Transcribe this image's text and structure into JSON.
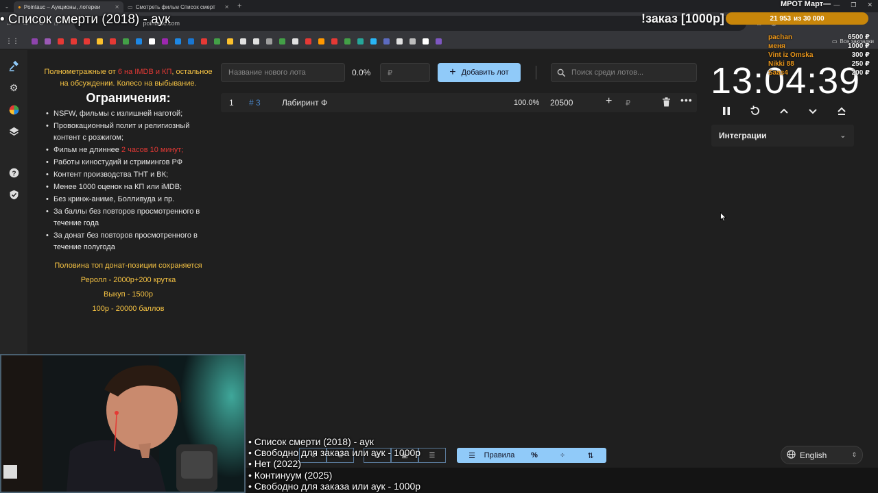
{
  "browser": {
    "tabs": [
      {
        "title": "Pointauc – Аукционы, лотереи"
      },
      {
        "title": "Смотреть фильм Список смерт"
      }
    ],
    "url": "pointauc.com",
    "bookmarks_folder": "Все закладки",
    "bookmark_colors": [
      "#8e44ad",
      "#9b59b6",
      "#e53935",
      "#e53935",
      "#e53935",
      "#fbc02d",
      "#e53935",
      "#43a047",
      "#1e88e5",
      "#ffffff",
      "#9c27b0",
      "#1e88e5",
      "#1976d2",
      "#e53935",
      "#43a047",
      "#fbc02d",
      "#e0e0e0",
      "#e0e0e0",
      "#9e9e9e",
      "#43a047",
      "#e0e0e0",
      "#e53935",
      "#ff9800",
      "#e53935",
      "#43a047",
      "#26a69a",
      "#29b6f6",
      "#5c6bc0",
      "#e0e0e0",
      "#bdbdbd",
      "#ffffff",
      "#7e57c2"
    ]
  },
  "overlay": {
    "stream_title": "• Список смерти (2018) - аук",
    "order_text": "!заказ [1000р]",
    "mrot_text": "МРОТ Март—",
    "goal_current": "21 953",
    "goal_text": "из 30 000",
    "goal_color": "#c8860a",
    "donors": [
      {
        "name": "pachan",
        "amount": "6500 ₽"
      },
      {
        "name": "меня",
        "amount": "1000 ₽"
      },
      {
        "name": "Vint iz Omska",
        "amount": "300 ₽"
      },
      {
        "name": "Nikki 88",
        "amount": "250 ₽"
      },
      {
        "name": "Saas4",
        "amount": "200 ₽"
      }
    ],
    "playlist": [
      "• Список смерти (2018) - аук",
      "• Свободно для заказа или аук - 1000р",
      "• Нет (2022)",
      "• Континуум (2025)",
      "• Свободно для заказа или аук - 1000р"
    ]
  },
  "rules": {
    "intro_a": "Полнометражные от ",
    "intro_red": "6 на IMDB и КП",
    "intro_b": ", остальное на обсуждении. Колесо на выбывание.",
    "heading": "Ограничения:",
    "items": [
      "NSFW, фильмы с излишней наготой;",
      "Провокационный полит и религиозный контент с розжигом;",
      "Работы киностудий и стримингов РФ",
      "Контент производства ТНТ и ВК;",
      "Менее 1000 оценок на КП или iMDB;",
      "Без кринж-аниме, Болливуда и пр.",
      "За баллы без повторов просмотренного в течение года",
      "За донат без повторов просмотренного в течение полугода"
    ],
    "length_item_a": "Фильм не длиннее ",
    "length_item_red": "2 часов 10 минут;",
    "footer": "Половина топ донат-позиции сохраняется",
    "reroll": "Реролл - 2000р+200 крутка",
    "buyout": "Выкуп - 1500р",
    "rate": "100р - 20000 баллов"
  },
  "toolbar": {
    "lot_name_placeholder": "Название нового лота",
    "percent": "0.0%",
    "amount_placeholder": "₽",
    "add_label": "Добавить лот",
    "search_placeholder": "Поиск среди лотов..."
  },
  "lots": [
    {
      "index": "1",
      "id": "# 3",
      "name": "Лабиринт Ф",
      "percent": "100.0%",
      "amount": "20500",
      "currency": "₽"
    }
  ],
  "timer": {
    "time": "13:04:39",
    "integrations_label": "Интеграции"
  },
  "bottom": {
    "rules_label": "Правила",
    "language": "English"
  },
  "colors": {
    "accent": "#90caf9",
    "rules_yellow": "#f6c343",
    "rules_red": "#e53935",
    "lot_id_blue": "#4a86c8"
  }
}
